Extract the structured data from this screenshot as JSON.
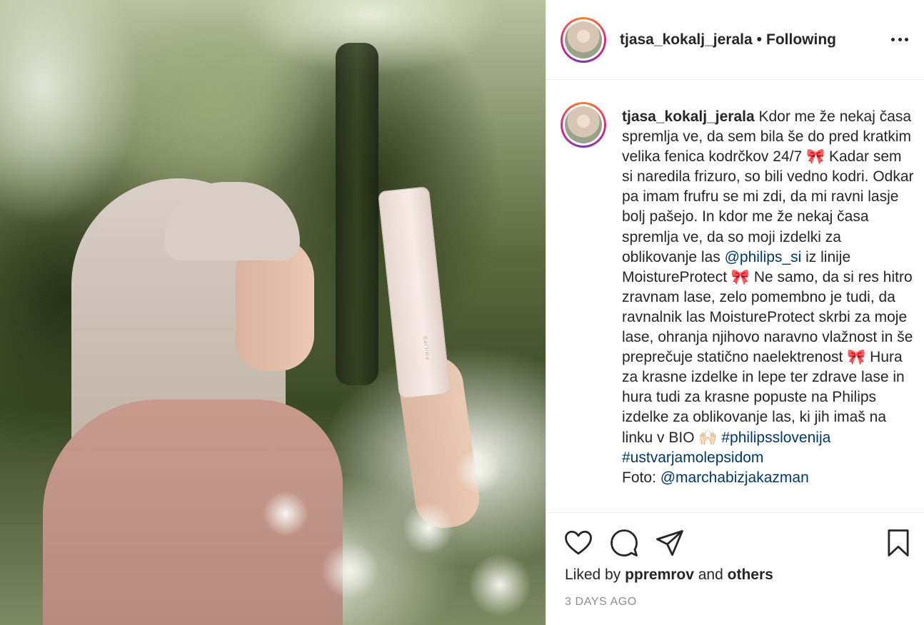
{
  "post": {
    "photo_alt": "Woman with long blonde hair holding a hair straightener in a field of white flowers",
    "brand_mark": "PHILIPS"
  },
  "header": {
    "username": "tjasa_kokalj_jerala",
    "separator": "•",
    "follow_status": "Following",
    "more_icon": "more-dots-icon"
  },
  "caption": {
    "username": "tjasa_kokalj_jerala",
    "text_1": "Kdor me že nekaj časa spremlja ve, da sem bila še do pred kratkim velika fenica kodrčkov 24/7 🎀 Kadar sem si naredila frizuro, so bili vedno kodri. Odkar pa imam frufru se mi zdi, da mi ravni lasje bolj pašejo. In kdor me že nekaj časa spremlja ve, da so moji izdelki za oblikovanje las ",
    "mention_1": "@philips_si",
    "text_2": " iz linije MoistureProtect 🎀  Ne samo, da si res hitro zravnam lase, zelo pomembno je tudi, da ravnalnik las MoistureProtect skrbi za moje lase, ohranja njihovo naravno vlažnost in še preprečuje statično naelektrenost 🎀  Hura za krasne izdelke in lepe ter zdrave lase in hura tudi za krasne popuste na Philips izdelke za oblikovanje las, ki jih imaš na linku v BIO 🙌🏻  ",
    "hashtag_1": "#philipsslovenija",
    "hashtag_2": "#ustvarjamolepsidom",
    "credit_label": "Foto: ",
    "mention_2": "@marchabizjakazman"
  },
  "actions": {
    "like_icon": "heart-icon",
    "comment_icon": "comment-icon",
    "share_icon": "share-icon",
    "save_icon": "bookmark-icon"
  },
  "likes": {
    "prefix": "Liked by ",
    "user": "ppremrov",
    "middle": " and ",
    "others": "others"
  },
  "timestamp": "3 DAYS AGO",
  "colors": {
    "text": "#262626",
    "link": "#00376b",
    "muted": "#8e8e8e",
    "border": "#efefef"
  }
}
